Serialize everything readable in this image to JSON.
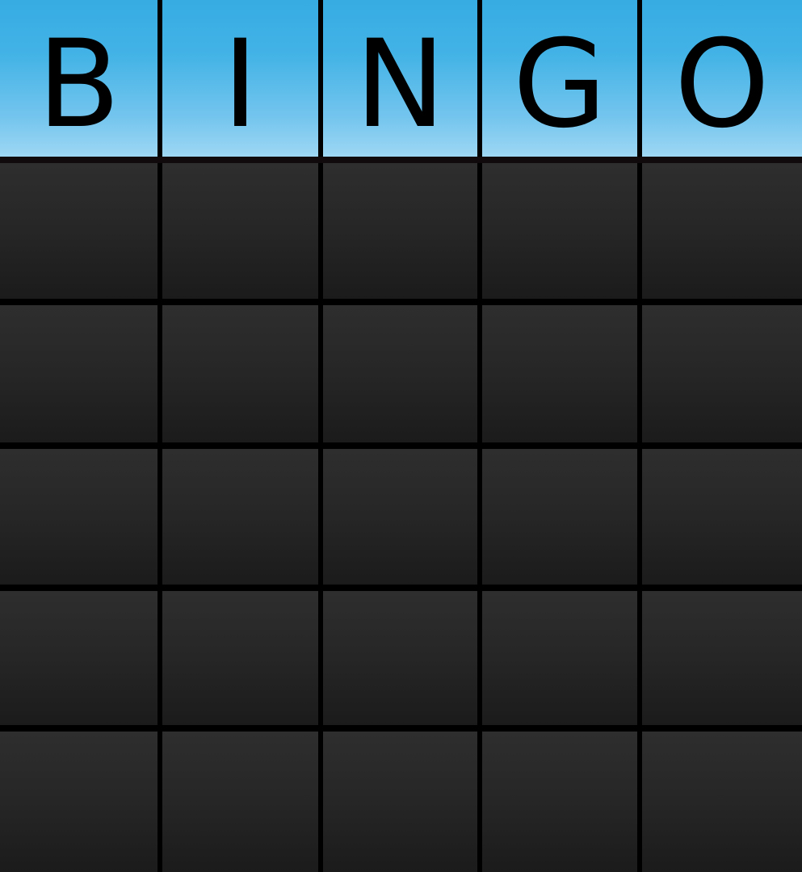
{
  "board": {
    "header_letters": [
      "B",
      "I",
      "N",
      "G",
      "O"
    ],
    "rows": 5,
    "columns": 5,
    "cells": [
      [
        "",
        "",
        "",
        "",
        ""
      ],
      [
        "",
        "",
        "",
        "",
        ""
      ],
      [
        "",
        "",
        "",
        "",
        ""
      ],
      [
        "",
        "",
        "",
        "",
        ""
      ],
      [
        "",
        "",
        "",
        "",
        ""
      ]
    ]
  },
  "colors": {
    "header_top": "#36ace3",
    "header_bottom": "#9ed7f3",
    "cell_top": "#2e2e2e",
    "cell_bottom": "#1b1b1b",
    "grid_line": "#000000"
  }
}
